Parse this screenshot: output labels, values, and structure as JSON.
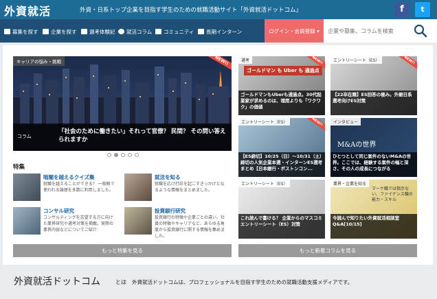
{
  "header": {
    "logo": "外資就活",
    "tagline": "外資・日系トップ企業を目指す学生のための就職活動サイト「外資就活ドットコム」",
    "social": [
      "f",
      "t"
    ]
  },
  "nav": {
    "items": [
      {
        "label": "募集を探す",
        "icon": "briefcase-icon"
      },
      {
        "label": "企業を探す",
        "icon": "building-icon"
      },
      {
        "label": "選考体験記",
        "icon": "book-icon"
      },
      {
        "label": "就活コラム",
        "icon": "column-icon"
      },
      {
        "label": "コミュニティ",
        "icon": "chat-icon"
      },
      {
        "label": "長期インターン",
        "icon": "monitor-icon"
      }
    ],
    "login": "ログイン・会員登録 ▾",
    "search_placeholder": "企業や募集、コラムを検索"
  },
  "hero": {
    "tag": "キャリアの悩み・挑戦",
    "badge": "NEW!!",
    "category": "コラム",
    "title": "「社会のために働きたい」それって官僚？ 民間？ その問い答えられますか"
  },
  "features": {
    "label": "特集",
    "items": [
      {
        "title": "暗闇を越えるクイズ集",
        "desc": "就職を越えることができる？ 一般概で使われる論理を多数に利用しました。"
      },
      {
        "title": "就活を知る",
        "desc": "就職を応け打診を起こすきっかけとなるような情報をまとめました。"
      },
      {
        "title": "コンサル研究",
        "desc": "コンサルティングを志望する方に向けた業界研究や選考対策を掲載。実際の業界内容などについてご紹介"
      },
      {
        "title": "投資銀行研究",
        "desc": "投資銀行の特徴や企業ごとの違い、社員の特徴やキャリアなど、あらゆる角度から投資銀行に関する情報を集めました。"
      }
    ],
    "more": "もっと特集を見る"
  },
  "columns": {
    "cards": [
      {
        "tag": "選考",
        "title": "ゴールドマンもUberも通過点。30代起業家が求めるのは、理屈よりも「ワクワク」の価値",
        "badge": "NEW!!",
        "img_text": "ゴールドマン も Uber も 通過点"
      },
      {
        "tag": "エントリーシート（ES）",
        "title": "【22卒在籍】ES回答の極み。外銀日系選考向けES対策",
        "badge": "NEW!!",
        "img_text": ""
      },
      {
        "tag": "エントリーシート（ES）",
        "title": "【ES締切】10/25（日）〜10/31（土）締切の人気企業本選・インターンES選考まとめ【日本銀行・ボストンコン...",
        "badge": "NEW!!",
        "img_text": ""
      },
      {
        "tag": "インタビュー",
        "title": "ひとつとして同じ案件のないM&Aの世界。ここでは、経験する案件の幅と深さ、その人の成長につながる",
        "badge": "",
        "img_text": "M&Aの世界"
      },
      {
        "tag": "エントリーシート（ES）",
        "title": "これ読んで書ける？ 企業からのマスコミエントリーシート（ES）対策",
        "badge": "",
        "img_text": ""
      },
      {
        "tag": "業界・企業を知る",
        "title": "今読んで知りたい外資就活相談室Q&A[10/15]",
        "badge": "",
        "img_text": "マーケ職では指示ない、ファイナンス職の能力・スキル"
      }
    ],
    "more": "もっと新着コラムを見る"
  },
  "about": {
    "title": "外資就活ドットコム",
    "to": "とは",
    "desc": "外資就活ドットコムは、プロフェッショナルを目指す学生のための就職活動支援メディアです。"
  },
  "colors": {
    "topbar": "#1e6b97",
    "navbar": "#1d4f77",
    "login": "#ef6a6a",
    "accent_link": "#1d66a8"
  }
}
